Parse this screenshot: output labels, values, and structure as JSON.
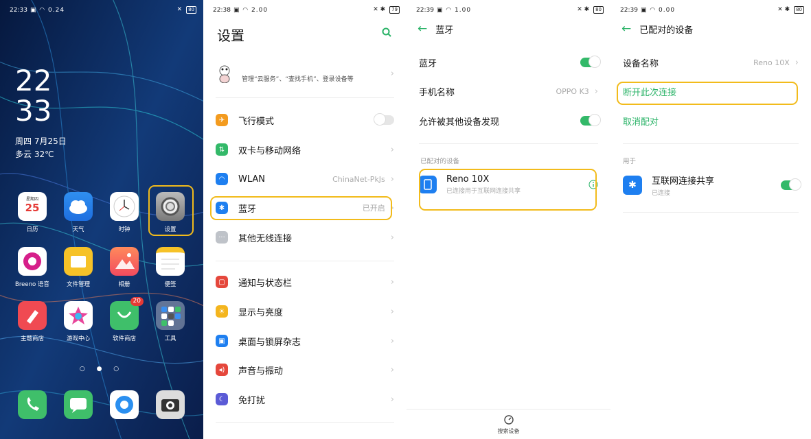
{
  "home": {
    "status": {
      "time": "22:33",
      "battery": "80",
      "net": "0.24"
    },
    "clock_hour": "22",
    "clock_min": "33",
    "date": "周四  7月25日",
    "weather": "多云 32℃",
    "calendar_widget": {
      "weekday": "星期四",
      "day": "25"
    },
    "apps": [
      {
        "label": "日历",
        "icon": "calendar-icon"
      },
      {
        "label": "天气",
        "icon": "weather-icon"
      },
      {
        "label": "时钟",
        "icon": "clock-icon"
      },
      {
        "label": "设置",
        "icon": "settings-gear-icon"
      },
      {
        "label": "Breeno 语音",
        "icon": "breeno-icon"
      },
      {
        "label": "文件管理",
        "icon": "folder-icon"
      },
      {
        "label": "相册",
        "icon": "photos-icon"
      },
      {
        "label": "便签",
        "icon": "notes-icon"
      },
      {
        "label": "主题商店",
        "icon": "theme-store-icon"
      },
      {
        "label": "游戏中心",
        "icon": "game-center-icon"
      },
      {
        "label": "软件商店",
        "icon": "app-store-icon",
        "badge": "20"
      },
      {
        "label": "工具",
        "icon": "tools-folder-icon"
      }
    ],
    "dock": [
      "phone-icon",
      "messages-icon",
      "browser-icon",
      "camera-icon"
    ],
    "page_dots": "○ ● ○"
  },
  "settings": {
    "status": {
      "time": "22:38",
      "battery": "79",
      "net": "2.00"
    },
    "title": "设置",
    "account_sub": "管理“云服务”、“查找手机”、登录设备等",
    "items": [
      {
        "label": "飞行模式",
        "icon": "airplane-icon",
        "color": "#f39b1f"
      },
      {
        "label": "双卡与移动网络",
        "icon": "sim-icon",
        "color": "#33b969"
      },
      {
        "label": "WLAN",
        "icon": "wifi-icon",
        "color": "#1e7ff0",
        "value": "ChinaNet-PkJs"
      },
      {
        "label": "蓝牙",
        "icon": "bluetooth-icon",
        "color": "#1e7ff0",
        "value": "已开启"
      },
      {
        "label": "其他无线连接",
        "icon": "more-icon",
        "color": "#bfc3c9"
      },
      {
        "label": "通知与状态栏",
        "icon": "notification-icon",
        "color": "#e5473c"
      },
      {
        "label": "显示与亮度",
        "icon": "brightness-icon",
        "color": "#f4b51e"
      },
      {
        "label": "桌面与锁屏杂志",
        "icon": "wallpaper-icon",
        "color": "#1e7ff0"
      },
      {
        "label": "声音与振动",
        "icon": "sound-icon",
        "color": "#e5473c"
      },
      {
        "label": "免打扰",
        "icon": "moon-icon",
        "color": "#5b5bd6"
      }
    ]
  },
  "bluetooth": {
    "status": {
      "time": "22:39",
      "battery": "80",
      "net": "1.00"
    },
    "title": "蓝牙",
    "bt_label": "蓝牙",
    "phone_name_label": "手机名称",
    "phone_name_value": "OPPO K3",
    "discoverable_label": "允许被其他设备发现",
    "paired_section": "已配对的设备",
    "device_name": "Reno  10X",
    "device_sub": "已连接用于互联网连接共享",
    "scan_label": "搜索设备"
  },
  "paired": {
    "status": {
      "time": "22:39",
      "battery": "80",
      "net": "0.00"
    },
    "title": "已配对的设备",
    "device_name_label": "设备名称",
    "device_name_value": "Reno  10X",
    "disconnect": "断开此次连接",
    "unpair": "取消配对",
    "used_for": "用于",
    "tether_label": "互联网连接共享",
    "tether_sub": "已连接"
  },
  "colors": {
    "accent": "#2bb368",
    "highlight": "#f2bb1b"
  }
}
